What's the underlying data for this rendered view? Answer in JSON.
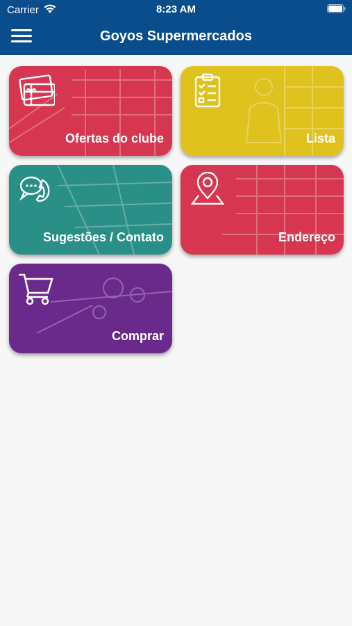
{
  "status_bar": {
    "carrier": "Carrier",
    "time": "8:23 AM"
  },
  "header": {
    "title": "Goyos Supermercados",
    "menu_icon": "hamburger-menu-icon",
    "background_color": "#0a4d8c"
  },
  "tiles": [
    {
      "label": "Ofertas do clube",
      "icon": "gift-card-icon",
      "color": "#d6364f"
    },
    {
      "label": "Lista",
      "icon": "clipboard-checklist-icon",
      "color": "#e0c21f"
    },
    {
      "label": "Sugestões / Contato",
      "icon": "chat-phone-icon",
      "color": "#2a8f87"
    },
    {
      "label": "Endereço",
      "icon": "map-pin-icon",
      "color": "#d6364f"
    },
    {
      "label": "Comprar",
      "icon": "shopping-cart-icon",
      "color": "#6a2a8c"
    }
  ]
}
